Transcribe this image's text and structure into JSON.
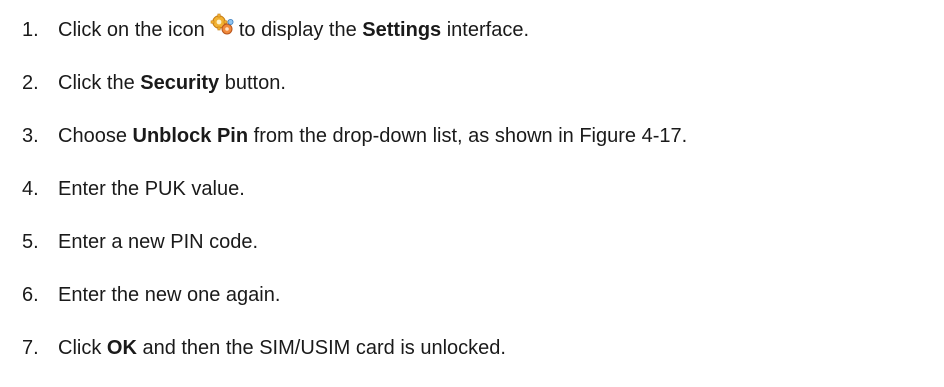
{
  "steps": [
    {
      "number": "1.",
      "parts": [
        {
          "text": "Click on the icon ",
          "bold": false
        },
        {
          "icon": "settings-gear-icon"
        },
        {
          "text": " to display the ",
          "bold": false
        },
        {
          "text": "Settings",
          "bold": true
        },
        {
          "text": " interface.",
          "bold": false
        }
      ]
    },
    {
      "number": "2.",
      "parts": [
        {
          "text": "Click the ",
          "bold": false
        },
        {
          "text": "Security",
          "bold": true
        },
        {
          "text": " button.",
          "bold": false
        }
      ]
    },
    {
      "number": "3.",
      "parts": [
        {
          "text": "Choose ",
          "bold": false
        },
        {
          "text": "Unblock Pin",
          "bold": true
        },
        {
          "text": " from the drop-down list, as shown in Figure 4-17.",
          "bold": false
        }
      ]
    },
    {
      "number": "4.",
      "parts": [
        {
          "text": "Enter the PUK value.",
          "bold": false
        }
      ]
    },
    {
      "number": "5.",
      "parts": [
        {
          "text": "Enter a new PIN code.",
          "bold": false
        }
      ]
    },
    {
      "number": "6.",
      "parts": [
        {
          "text": "Enter the new one again.",
          "bold": false
        }
      ]
    },
    {
      "number": "7.",
      "parts": [
        {
          "text": "Click ",
          "bold": false
        },
        {
          "text": "OK",
          "bold": true
        },
        {
          "text": " and then the SIM/USIM card is unlocked.",
          "bold": false
        }
      ]
    }
  ]
}
